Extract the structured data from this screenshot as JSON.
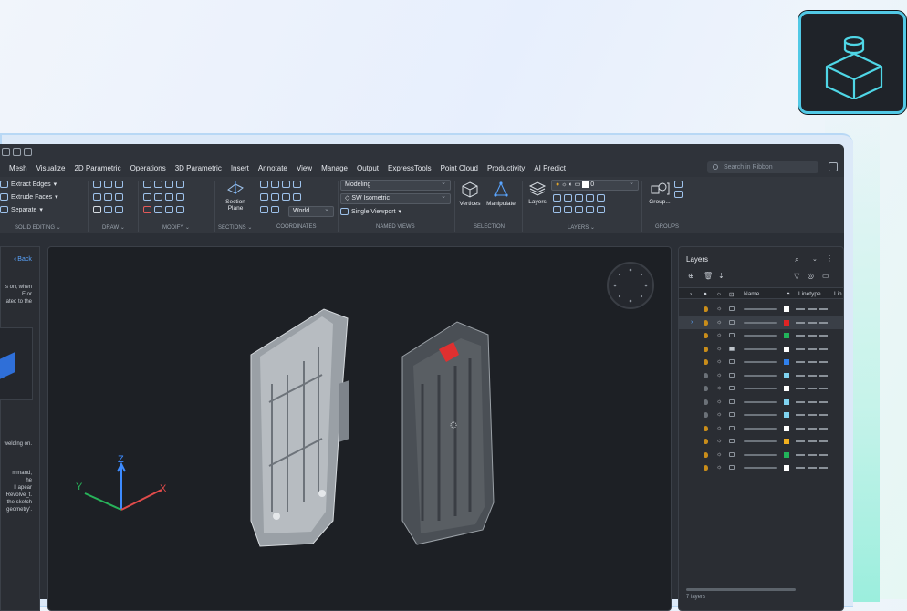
{
  "ribbon_tabs": [
    "Mesh",
    "Visualize",
    "2D Parametric",
    "Operations",
    "3D Parametric",
    "Insert",
    "Annotate",
    "View",
    "Manage",
    "Output",
    "ExpressTools",
    "Point Cloud",
    "Productivity",
    "AI Predict"
  ],
  "search_placeholder": "Search in Ribbon",
  "solid_editing": {
    "extract_edges": "Extract Edges",
    "extrude_faces": "Extrude Faces",
    "separate": "Separate",
    "label": "SOLID EDITING"
  },
  "groups": {
    "draw": "DRAW",
    "modify": "MODIFY",
    "sections": "SECTIONS",
    "coordinates": "COORDINATES",
    "named_views": "NAMED VIEWS",
    "selection": "SELECTION",
    "layers": "LAYERS",
    "groups": "GROUPS"
  },
  "section_plane": "Section Plane",
  "coordinates_world": "World",
  "named_views": {
    "workspace": "Modeling",
    "view": "SW Isometric",
    "viewport": "Single Viewport"
  },
  "selection": {
    "vertices": "Vertices",
    "manipulate": "Manipulate"
  },
  "layers_button": "Layers",
  "layer_current": "0",
  "group_button": "Group...",
  "left_panel": {
    "back": "Back",
    "text1": [
      "s on, when",
      "E or",
      "ated to the"
    ],
    "text2": "welding on.",
    "text3": [
      "mmand,",
      "he",
      "ll apear",
      "Revolve_t.",
      "",
      "the sketch",
      "geometry'."
    ]
  },
  "axes": {
    "x": "X",
    "y": "Y",
    "z": "Z"
  },
  "layers_panel": {
    "title": "Layers",
    "col_name": "Name",
    "col_linetype": "Linetype",
    "col_lineweight": "Lin",
    "footer": "7 layers",
    "rows": [
      {
        "on": true,
        "locked": false,
        "color": "#ffffff",
        "selected": false
      },
      {
        "on": true,
        "locked": false,
        "color": "#e02424",
        "selected": true
      },
      {
        "on": true,
        "locked": false,
        "color": "#22b35a",
        "selected": false
      },
      {
        "on": true,
        "locked": true,
        "color": "#ffffff",
        "selected": false
      },
      {
        "on": true,
        "locked": false,
        "color": "#2f80ed",
        "selected": false
      },
      {
        "on": false,
        "locked": false,
        "color": "#7fd3f0",
        "selected": false
      },
      {
        "on": false,
        "locked": false,
        "color": "#ffffff",
        "selected": false
      },
      {
        "on": false,
        "locked": false,
        "color": "#7fd3f0",
        "selected": false
      },
      {
        "on": false,
        "locked": false,
        "color": "#7fd3f0",
        "selected": false
      },
      {
        "on": true,
        "locked": false,
        "color": "#ffffff",
        "selected": false
      },
      {
        "on": true,
        "locked": false,
        "color": "#f2b01e",
        "selected": false
      },
      {
        "on": true,
        "locked": false,
        "color": "#22b35a",
        "selected": false
      },
      {
        "on": true,
        "locked": false,
        "color": "#ffffff",
        "selected": false
      }
    ]
  }
}
